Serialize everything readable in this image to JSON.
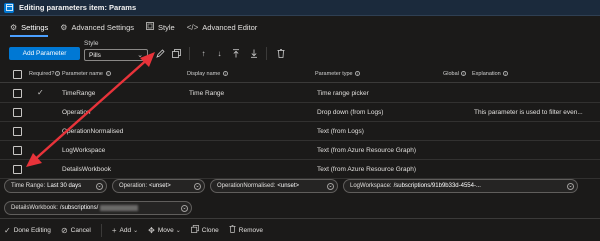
{
  "title_bar": {
    "title": "Editing parameters item: Params"
  },
  "tabs": [
    {
      "label": "Settings",
      "icon": "gear-icon",
      "active": true
    },
    {
      "label": "Advanced Settings",
      "icon": "gear-icon",
      "active": false
    },
    {
      "label": "Style",
      "icon": "style-icon",
      "active": false
    },
    {
      "label": "Advanced Editor",
      "icon": "code-icon",
      "active": false
    }
  ],
  "toolbar": {
    "add_parameter_label": "Add Parameter",
    "style_label": "Style",
    "style_value": "Pills",
    "icons": [
      "edit-icon",
      "copy-icon",
      "move-up-icon",
      "move-down-icon",
      "move-top-icon",
      "move-bottom-icon",
      "delete-icon"
    ]
  },
  "grid": {
    "headers": {
      "required": "Required?",
      "parameter_name": "Parameter name",
      "display_name": "Display name",
      "parameter_type": "Parameter type",
      "global": "Global",
      "explanation": "Explanation"
    },
    "rows": [
      {
        "required": true,
        "name": "TimeRange",
        "display": "Time Range",
        "type": "Time range picker",
        "explanation": ""
      },
      {
        "required": false,
        "name": "Operation",
        "display": "",
        "type": "Drop down (from Logs)",
        "explanation": "This parameter is used to filter even..."
      },
      {
        "required": false,
        "name": "OperationNormalised",
        "display": "",
        "type": "Text (from Logs)",
        "explanation": ""
      },
      {
        "required": false,
        "name": "LogWorkspace",
        "display": "",
        "type": "Text (from Azure Resource Graph)",
        "explanation": ""
      },
      {
        "required": false,
        "name": "DetailsWorkbook",
        "display": "",
        "type": "Text (from Azure Resource Graph)",
        "explanation": ""
      }
    ]
  },
  "pills": {
    "time_range": {
      "label": "Time Range:",
      "value": "Last 30 days"
    },
    "operation": {
      "label": "Operation:",
      "value": "<unset>"
    },
    "operation_normalised": {
      "label": "OperationNormalised:",
      "value": "<unset>"
    },
    "log_workspace": {
      "label": "LogWorkspace:",
      "value": "/subscriptions/91b9b33d-4554-..."
    },
    "details_workbook": {
      "label": "DetailsWorkbook:",
      "value": "/subscriptions/"
    }
  },
  "footer": {
    "done_label": "Done Editing",
    "cancel_label": "Cancel",
    "add_label": "Add",
    "move_label": "Move",
    "clone_label": "Clone",
    "remove_label": "Remove"
  },
  "colors": {
    "accent": "#0078d4",
    "annotation_arrow": "#e8333a",
    "background": "#1b1a19"
  }
}
